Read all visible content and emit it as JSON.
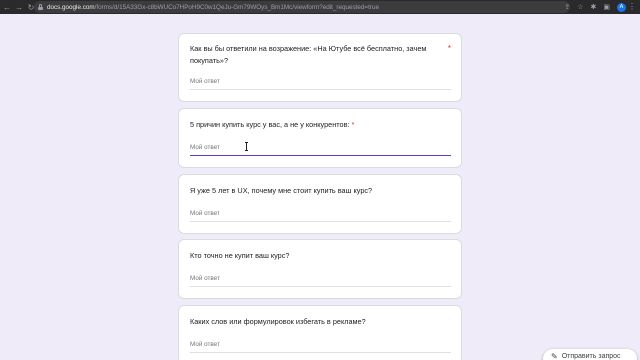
{
  "browser": {
    "back_icon": "←",
    "forward_icon": "→",
    "reload_icon": "↻",
    "url_host": "docs.google.com",
    "url_path": "/forms/d/15A33Gx-c8bWUCo7HPoH9C0w1QeJu-Gm79WOys_Bm1Mc/viewform?edit_requested=true",
    "share_icon": "⇪",
    "star_icon": "☆",
    "extensions_icon": "✱",
    "sidebar_icon": "▣",
    "profile_initial": "A",
    "menu_icon": "⋮"
  },
  "form": {
    "required_mark": "*",
    "questions": [
      {
        "title_line1": "Как вы бы ответили на возражение: «На Ютубе всё бесплатно, зачем",
        "title_line2": "покупать»?",
        "placeholder": "Мой ответ",
        "required": true
      },
      {
        "title": "5 причин купить курс у вас, а не у конкурентов:",
        "placeholder": "Мой ответ",
        "required": true
      },
      {
        "title": "Я уже 5 лет в UX, почему мне стоит купить ваш курс?",
        "placeholder": "Мой ответ"
      },
      {
        "title": "Кто точно не купит ваш курс?",
        "placeholder": "Мой ответ"
      },
      {
        "title": "Каких слов или формулировок избегать в рекламе?",
        "placeholder": "Мой ответ"
      }
    ]
  },
  "report_button": {
    "label": "Отправить запрос",
    "icon": "✎"
  },
  "colors": {
    "background": "#f0ebf8",
    "accent": "#673ab7",
    "required": "#d93025"
  }
}
